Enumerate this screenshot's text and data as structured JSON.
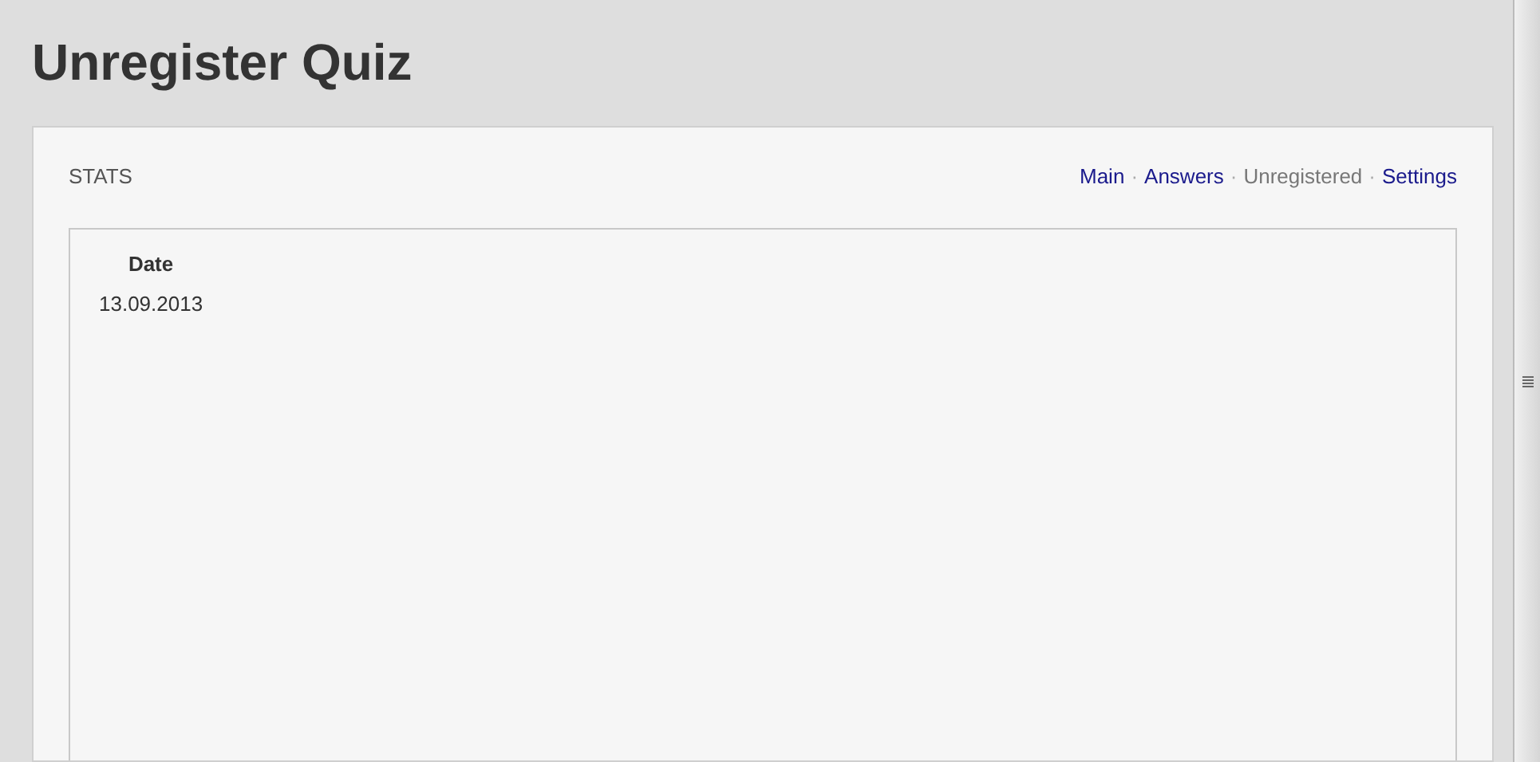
{
  "page_title": "Unregister Quiz",
  "panel": {
    "heading": "STATS",
    "nav": {
      "separator": "·",
      "items": [
        {
          "label": "Main",
          "selected": false
        },
        {
          "label": "Answers",
          "selected": false
        },
        {
          "label": "Unregistered",
          "selected": true
        },
        {
          "label": "Settings",
          "selected": false
        }
      ]
    },
    "table": {
      "columns": [
        "Date"
      ],
      "rows": [
        [
          "13.09.2013"
        ]
      ]
    }
  }
}
